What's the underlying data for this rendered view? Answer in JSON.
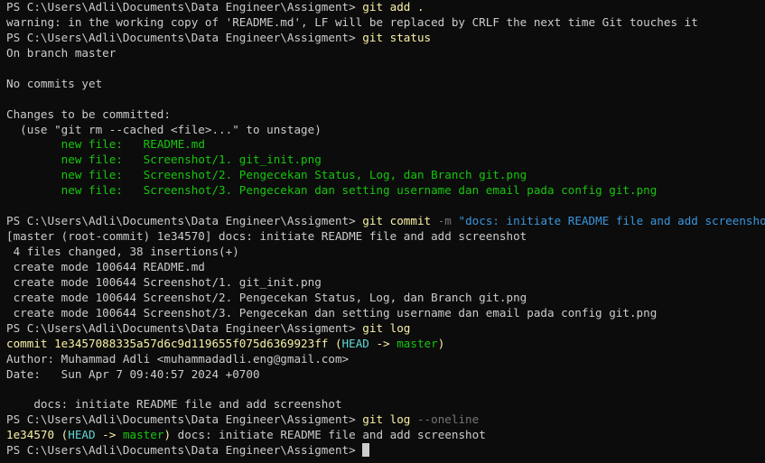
{
  "theme": {
    "background": "#0c0c0c",
    "foreground": "#cccccc",
    "command": "#f9f1a5",
    "new_file": "#16c60c",
    "flag": "#767676",
    "string": "#3a96dd",
    "head": "#61d6d6"
  },
  "terminal": {
    "prompt": "PS C:\\Users\\Adli\\Documents\\Data Engineer\\Assigment>",
    "cmd1": {
      "name": "git",
      "args": "add ."
    },
    "warning": "warning: in the working copy of 'README.md', LF will be replaced by CRLF the next time Git touches it",
    "cmd2": {
      "name": "git",
      "args": "status"
    },
    "branch_line": "On branch master",
    "no_commits": "No commits yet",
    "changes_header": "Changes to be committed:",
    "unstage_hint": "  (use \"git rm --cached <file>...\" to unstage)",
    "staged_files": [
      {
        "status": "        new file:   ",
        "path": "README.md"
      },
      {
        "status": "        new file:   ",
        "path": "Screenshot/1. git_init.png"
      },
      {
        "status": "        new file:   ",
        "path": "Screenshot/2. Pengecekan Status, Log, dan Branch git.png"
      },
      {
        "status": "        new file:   ",
        "path": "Screenshot/3. Pengecekan dan setting username dan email pada config git.png"
      }
    ],
    "cmd3": {
      "name": "git",
      "args": "commit",
      "flag": "-m",
      "message": "\"docs: initiate README file and add screenshot\""
    },
    "commit_result": "[master (root-commit) 1e34570] docs: initiate README file and add screenshot",
    "commit_stats": " 4 files changed, 38 insertions(+)",
    "create_modes": [
      " create mode 100644 README.md",
      " create mode 100644 Screenshot/1. git_init.png",
      " create mode 100644 Screenshot/2. Pengecekan Status, Log, dan Branch git.png",
      " create mode 100644 Screenshot/3. Pengecekan dan setting username dan email pada config git.png"
    ],
    "cmd4": {
      "name": "git",
      "args": "log"
    },
    "log": {
      "commit_prefix": "commit 1e3457088335a57d6c9d119655f075d6369923ff (",
      "head": "HEAD",
      "arrow": " -> ",
      "branch": "master",
      "close": ")",
      "author": "Author: Muhammad Adli <muhammadadli.eng@gmail.com>",
      "date": "Date:   Sun Apr 7 09:40:57 2024 +0700",
      "message": "    docs: initiate README file and add screenshot"
    },
    "cmd5": {
      "name": "git",
      "args": "log",
      "flag": "--oneline"
    },
    "oneline": {
      "hash": "1e34570",
      "open": " (",
      "head": "HEAD",
      "arrow": " -> ",
      "branch": "master",
      "close": ")",
      "message": " docs: initiate README file and add screenshot"
    }
  }
}
